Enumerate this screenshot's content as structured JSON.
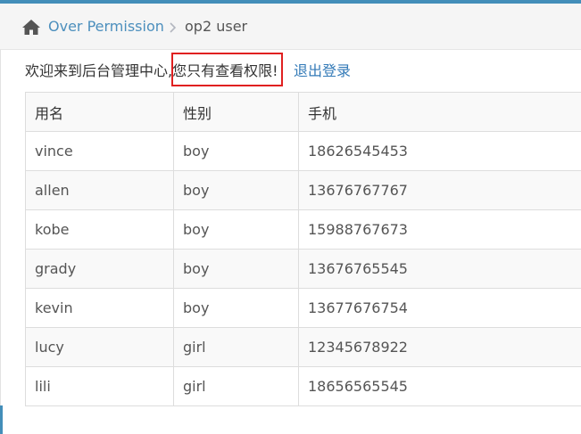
{
  "breadcrumb": {
    "home_icon": "home-icon",
    "parent": "Over Permission",
    "separator_icon": "chevron-right-icon",
    "current": "op2 user"
  },
  "welcome": {
    "greeting": "欢迎来到后台管理中心,",
    "permission_notice": "您只有查看权限!",
    "logout": "退出登录"
  },
  "table": {
    "headers": [
      "用名",
      "性别",
      "手机"
    ],
    "rows": [
      [
        "vince",
        "boy",
        "18626545453"
      ],
      [
        "allen",
        "boy",
        "13676767767"
      ],
      [
        "kobe",
        "boy",
        "15988767673"
      ],
      [
        "grady",
        "boy",
        "13676765545"
      ],
      [
        "kevin",
        "boy",
        "13677676754"
      ],
      [
        "lucy",
        "girl",
        "12345678922"
      ],
      [
        "lili",
        "girl",
        "18656565545"
      ]
    ]
  },
  "colors": {
    "accent": "#438eb9",
    "link": "#4c8fbd",
    "highlight_border": "#e02020"
  }
}
